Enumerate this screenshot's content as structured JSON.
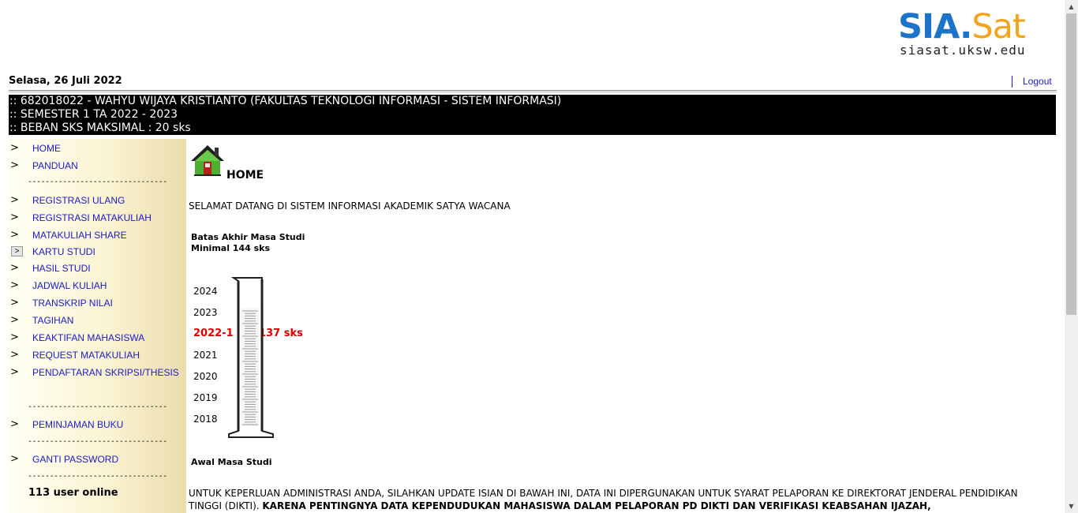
{
  "logo": {
    "sia": "SIA",
    "dot": ".",
    "sat": "Sat",
    "url": "siasat.uksw.edu",
    "colors": {
      "sia": "#1b74c7",
      "sat": "#f5a21c"
    }
  },
  "header": {
    "date": "Selasa, 26 Juli 2022",
    "logout_label": "Logout"
  },
  "infobar": {
    "line1": ":: 682018022 - WAHYU WIJAYA KRISTIANTO (FAKULTAS TEKNOLOGI INFORMASI - SISTEM INFORMASI)",
    "line2": ":: SEMESTER 1 TA 2022 - 2023",
    "line3": ":: BEBAN SKS MAKSIMAL : 20 sks"
  },
  "sidebar": {
    "arrow": ">",
    "separator": "--------------------------------",
    "items": [
      {
        "label": "HOME"
      },
      {
        "label": "PANDUAN"
      },
      {
        "label": "REGISTRASI ULANG"
      },
      {
        "label": "REGISTRASI MATAKULIAH"
      },
      {
        "label": "MATAKULIAH SHARE"
      },
      {
        "label": "KARTU STUDI"
      },
      {
        "label": "HASIL STUDI"
      },
      {
        "label": "JADWAL KULIAH"
      },
      {
        "label": "TRANSKRIP NILAI"
      },
      {
        "label": "TAGIHAN"
      },
      {
        "label": "KEAKTIFAN MAHASISWA"
      },
      {
        "label": "REQUEST MATAKULIAH"
      },
      {
        "label": "PENDAFTARAN SKRIPSI/THESIS"
      },
      {
        "label": "PEMINJAMAN BUKU"
      },
      {
        "label": "GANTI PASSWORD"
      }
    ],
    "online": "113 user online"
  },
  "main": {
    "title": "HOME",
    "welcome": "SELAMAT DATANG DI SISTEM INFORMASI AKADEMIK SATYA WACANA",
    "batas_line1": "Batas Akhir Masa Studi",
    "batas_line2": "Minimal 144 sks",
    "years": [
      "2024",
      "2023",
      "2021",
      "2020",
      "2019",
      "2018"
    ],
    "current_semester": "2022-1",
    "current_dash": "-----",
    "current_sks": "137 sks",
    "awal": "Awal Masa Studi",
    "para_normal": "UNTUK KEPERLUAN ADMINISTRASI ANDA, SILAHKAN UPDATE ISIAN DI BAWAH INI, DATA INI DIPERGUNAKAN UNTUK SYARAT PELAPORAN KE DIREKTORAT JENDERAL PENDIDIKAN TINGGI (DIKTI). ",
    "para_bold": "KARENA PENTINGNYA DATA KEPENDUDUKAN MAHASISWA DALAM PELAPORAN PD DIKTI DAN VERIFIKASI KEABSAHAN IJAZAH,",
    "accent_red": "#e00000",
    "link_color": "#1a1acd"
  },
  "scrollbar": {
    "up": "▲",
    "down": "▼"
  }
}
